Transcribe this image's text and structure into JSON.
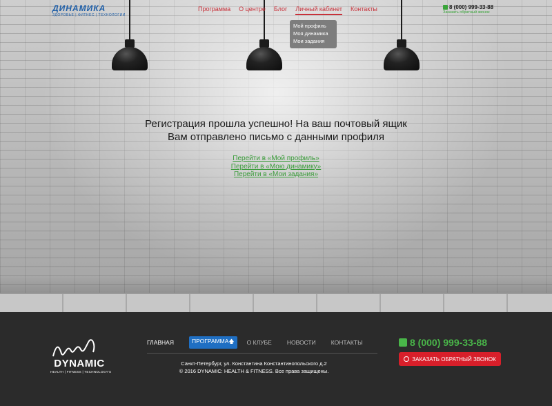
{
  "header": {
    "logo_text": "ДИНАМИКА",
    "logo_tagline": "ЗДОРОВЬЕ | ФИТНЕС | ТЕХНОЛОГИИ",
    "nav": [
      {
        "label": "Программа"
      },
      {
        "label": "О центре"
      },
      {
        "label": "Блог"
      },
      {
        "label": "Личный кабинет",
        "active": true
      },
      {
        "label": "Контакты"
      }
    ],
    "dropdown": [
      "Мой профиль",
      "Моя динамика",
      "Мои задания"
    ],
    "phone": "8 (000) 999-33-88",
    "callback": "Заказать обратный звонок"
  },
  "message": {
    "line1": "Регистрация прошла успешно! На ваш почтовый ящик",
    "line2": "Вам отправлено письмо с данными профиля"
  },
  "links": [
    "Перейти в «Мой профиль»",
    "Перейти в «Мою динамику»",
    "Перейти в «Мои задания»"
  ],
  "footer": {
    "logo_text": "DYNAMIC",
    "logo_tagline": "HEALTH | FITNESS | TECHNOLOGY'S",
    "nav": {
      "home": "Главная",
      "program": "Программа",
      "about": "О клубе",
      "news": "Новости",
      "contacts": "Контакты"
    },
    "address": "Санкт-Петербург, ул. Константина Константинопольского д.2",
    "copyright": "© 2016 DYNAMIC: HEALTH & FITNESS. Все права защищены.",
    "phone": "8 (000) 999-33-88",
    "callback_button": "Заказать обратный звонок"
  },
  "colors": {
    "accent_red": "#c8313a",
    "accent_green": "#3a9c3a",
    "accent_blue": "#1f6fc3",
    "footer_bg": "#2b2b2b"
  }
}
